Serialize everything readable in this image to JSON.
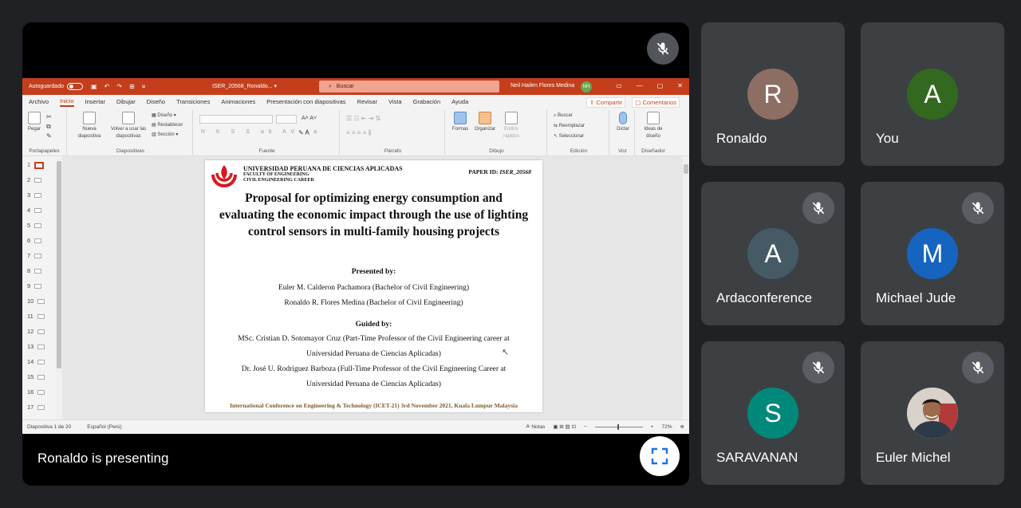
{
  "presentation": {
    "presenting_label": "Ronaldo is presenting",
    "mic_state": "muted",
    "fullscreen_icon": "fullscreen-icon"
  },
  "powerpoint": {
    "autosave_label": "Autoguardado",
    "doc_name": "ISER_20568_Ronaldo... ▾",
    "search_placeholder": "Buscar",
    "user_name": "Neil Hailen Flores Medina",
    "user_initials": "NH",
    "menu": [
      "Archivo",
      "Inicio",
      "Insertar",
      "Dibujar",
      "Diseño",
      "Transiciones",
      "Animaciones",
      "Presentación con diapositivas",
      "Revisar",
      "Vista",
      "Grabación",
      "Ayuda"
    ],
    "active_menu": "Inicio",
    "share_label": "Compartir",
    "comments_label": "Comentarios",
    "ribbon": {
      "paste_label": "Pegar",
      "clipboard_group": "Portapapeles",
      "new_slide_label": "Nueva diapositiva",
      "reuse_label": "Volver a usar las diapositivas",
      "layout_label": "Diseño ▾",
      "reset_label": "Restablecer",
      "section_label": "Sección ▾",
      "slides_group": "Diapositivas",
      "font_group": "Fuente",
      "font_buttons": "N K S S ab AV Aa",
      "paragraph_group": "Párrafo",
      "shapes_label": "Formas",
      "arrange_label": "Organizar",
      "quick_styles_label": "Estilos rápidos",
      "drawing_group": "Dibujo",
      "find_label": "Buscar",
      "replace_label": "Reemplazar",
      "select_label": "Seleccionar",
      "editing_group": "Edición",
      "dictate_label": "Dictar",
      "voice_group": "Voz",
      "design_ideas_label": "Ideas de diseño",
      "designer_group": "Diseñador"
    },
    "slide_numbers": [
      "1",
      "2",
      "3",
      "4",
      "5",
      "6",
      "7",
      "8",
      "9",
      "10",
      "11",
      "12",
      "13",
      "14",
      "15",
      "16",
      "17"
    ],
    "active_slide": 1,
    "status": {
      "slide_count": "Diapositiva 1 de 20",
      "language": "Español (Perú)",
      "notes_label": "Notas",
      "zoom": "72%"
    }
  },
  "slide": {
    "university": "UNIVERSIDAD PERUANA DE CIENCIAS APLICADAS",
    "faculty": "FACULTY OF ENGINEERING",
    "career": "CIVIL ENGINEERING CAREER",
    "paper_id_label": "PAPER ID:",
    "paper_id": "ISER_20568",
    "title": "Proposal for optimizing energy consumption and evaluating the economic impact through the use of lighting control sensors in multi-family housing projects",
    "presented_by": "Presented by:",
    "author1": "Euler M. Calderon Pachamora (Bachelor of Civil Engineering)",
    "author2": "Ronaldo R. Flores Medina (Bachelor of Civil Engineering)",
    "guided_by": "Guided by:",
    "advisor1_l1": "MSc. Cristian D. Sotomayor Cruz (Part-Time Professor of the Civil Engineering career at",
    "advisor1_l2": "Universidad Peruana de Ciencias Aplicadas)",
    "advisor2_l1": "Dr. José U. Rodriguez Barboza (Full-Time Professor of the Civil Engineering Career at",
    "advisor2_l2": "Universidad Peruana de Ciencias Aplicadas)",
    "conference": "International Conference on Engineering & Technology (ICET-21) 3rd November 2021, Kuala Lumpur Malaysia"
  },
  "participants": [
    {
      "name": "Ronaldo",
      "initial": "R",
      "color": "#8d6e63",
      "muted": false
    },
    {
      "name": "You",
      "initial": "A",
      "color": "#33691e",
      "muted": false
    },
    {
      "name": "Ardaconference",
      "initial": "A",
      "color": "#455a64",
      "muted": true
    },
    {
      "name": "Michael Jude",
      "initial": "M",
      "color": "#1565c0",
      "muted": true
    },
    {
      "name": "SARAVANAN",
      "initial": "S",
      "color": "#00897b",
      "muted": true
    },
    {
      "name": "Euler Michel",
      "initial": "",
      "color": "#bdb6ae",
      "muted": true
    }
  ]
}
